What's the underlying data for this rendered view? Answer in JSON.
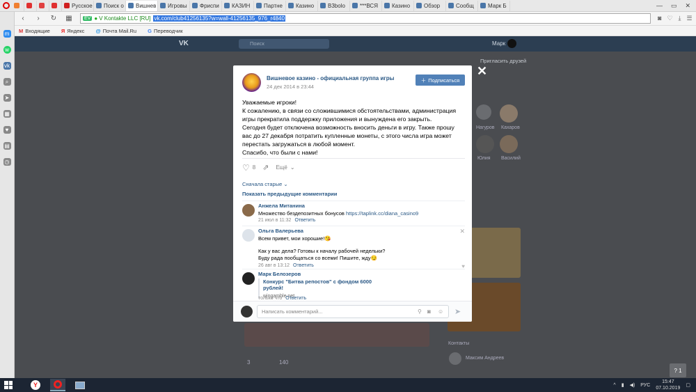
{
  "browser": {
    "tabs": [
      {
        "label": "",
        "color": "#f08030"
      },
      {
        "label": "",
        "color": "#e03030"
      },
      {
        "label": "",
        "color": "#e04040"
      },
      {
        "label": "",
        "color": "#e03030"
      },
      {
        "label": "Русское",
        "color": "#d02020"
      },
      {
        "label": "Поиск о",
        "color": "#4a76a8"
      },
      {
        "label": "Вишнев",
        "color": "#4a76a8"
      },
      {
        "label": "Игровы",
        "color": "#4a76a8"
      },
      {
        "label": "Фриспи",
        "color": "#4a76a8"
      },
      {
        "label": "КАЗИН",
        "color": "#4a76a8"
      },
      {
        "label": "Партне",
        "color": "#4a76a8"
      },
      {
        "label": "Казино",
        "color": "#4a76a8"
      },
      {
        "label": "B3bolo",
        "color": "#4a76a8"
      },
      {
        "label": "***ВСЯ",
        "color": "#4a76a8"
      },
      {
        "label": "Казино",
        "color": "#4a76a8"
      },
      {
        "label": "Обзор",
        "color": "#4a76a8"
      },
      {
        "label": "Сообщ",
        "color": "#4a76a8"
      },
      {
        "label": "Марк Б",
        "color": "#4a76a8"
      }
    ],
    "active_tab": 6,
    "address": {
      "ev_badge": "EV",
      "org": "V Kontakte LLC [RU]",
      "url": "vk.com/club41256135?w=wall-41256135_976_r4840"
    },
    "bookmarks": [
      "Входящие",
      "Яндекс",
      "Почта Mail.Ru",
      "Переводчик"
    ]
  },
  "post": {
    "group_name": "Вишневое казино - официальная группа игры",
    "date": "24 дек 2014 в 23:44",
    "subscribe_label": "Подписаться",
    "lines": [
      "Уважаемые игроки!",
      "К сожалению, в связи со сложившимися обстоятельствами, администрация игры прекратила поддержку приложения и вынуждена его закрыть.",
      "Сегодня будет отключена возможность вносить деньги в игру. Также прошу вас до 27 декабря потратить купленные монеты, с этого числа игра может перестать загружаться в любой момент.",
      "Спасибо, что были с нами!"
    ],
    "likes": "8",
    "more_label": "Ещё"
  },
  "comments_header": {
    "sort_label": "Сначала старые",
    "show_prev": "Показать предыдущие комментарии"
  },
  "comments": [
    {
      "author": "Анжела Митанина",
      "text": "Множество бездепозитных бонусов ",
      "link": "https://taplink.cc/diana_casino9",
      "date": "21 июл в 11:32",
      "reply": "Ответить"
    },
    {
      "author": "Ольга Валерьева",
      "text1": "Всем привет, мои хорошие!",
      "text2": "Как у вас дела? Готовы к началу рабочей недельки?",
      "text3": "Буду рада пообщаться со всеми! Пишите, жду",
      "date": "26 авг в 13:12",
      "reply": "Ответить"
    },
    {
      "author": "Марк Белозеров",
      "snippet_title": "Конкурс \"Битва репостов\" с фондом 6000 рублей!",
      "snippet_domain": "wingamble.net",
      "date": "только что",
      "reply": "Ответить"
    }
  ],
  "composer": {
    "placeholder": "Написать комментарий..."
  },
  "background": {
    "search": "Поиск",
    "user": "Марк",
    "right_items": [
      "Пригласить друзей",
      "Нагуров",
      "Кахаров",
      "Юлия",
      "Василий",
      "Контакты",
      "Максим Андреев"
    ],
    "post_stats": [
      "3",
      "140"
    ]
  },
  "taskbar": {
    "lang": "РУС",
    "time": "15:47",
    "date": "07.10.2019"
  },
  "help_label": "? 1"
}
